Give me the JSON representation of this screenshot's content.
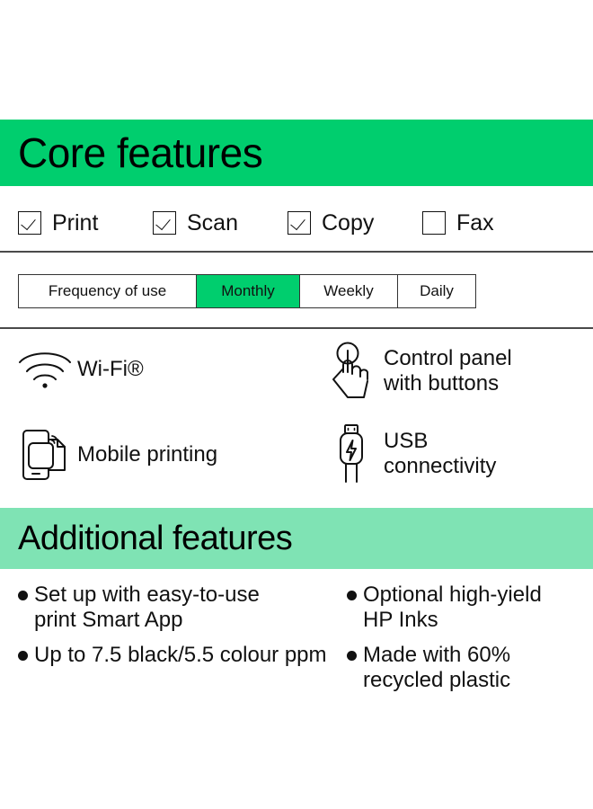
{
  "core": {
    "heading": "Core features",
    "checkboxes": [
      {
        "label": "Print",
        "checked": true,
        "icon": "checkbox-checked-icon"
      },
      {
        "label": "Scan",
        "checked": true,
        "icon": "checkbox-checked-icon"
      },
      {
        "label": "Copy",
        "checked": true,
        "icon": "checkbox-checked-icon"
      },
      {
        "label": "Fax",
        "checked": false,
        "icon": "checkbox-unchecked-icon"
      }
    ],
    "frequency_table": {
      "row_label": "Frequency of use",
      "options": [
        "Monthly",
        "Weekly",
        "Daily"
      ],
      "selected": "Monthly"
    },
    "features": [
      {
        "icon": "wifi-icon",
        "label": "Wi-Fi®"
      },
      {
        "icon": "touch-hand-icon",
        "label": "Control panel\nwith buttons"
      },
      {
        "icon": "mobile-print-icon",
        "label": "Mobile printing"
      },
      {
        "icon": "usb-cable-icon",
        "label": "USB\nconnectivity"
      }
    ]
  },
  "additional": {
    "heading": "Additional features",
    "bullets_left": [
      "Set up with easy-to-use\nprint Smart App",
      "Up to 7.5 black/5.5 colour ppm"
    ],
    "bullets_right": [
      "Optional high-yield\nHP Inks",
      "Made with 60%\nrecycled plastic"
    ]
  },
  "colors": {
    "core_band": "#00CE6E",
    "additional_band": "#7FE3B4",
    "selected_cell": "#00CE6E",
    "text": "#111111",
    "rule": "#4a4a4a"
  }
}
